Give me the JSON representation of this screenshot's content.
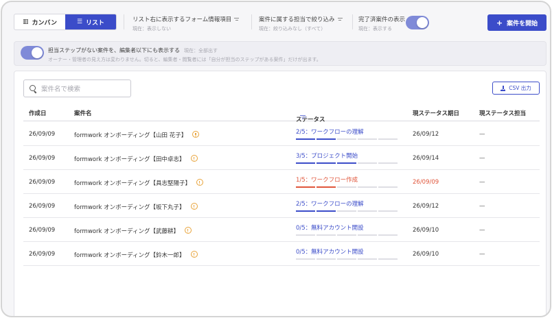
{
  "view_toggle": {
    "kanban_label": "カンバン",
    "list_label": "リスト",
    "active": "list"
  },
  "filters": [
    {
      "title": "リスト右に表示するフォーム情報項目",
      "sub": "現在：表示しない"
    },
    {
      "title": "案件に属する担当で絞り込み",
      "sub": "現在：絞り込みなし（すべて）"
    }
  ],
  "completed_toggle": {
    "title": "完了済案件の表示",
    "sub": "現在：表示する",
    "on": true
  },
  "start_button": {
    "label": "案件を開始"
  },
  "banner": {
    "title": "担当ステップがない案件を、編集者以下にも表示する",
    "note": "現在：全部出す",
    "desc": "オーナー・管理者の見え方は変わりません。切ると、編集者・閲覧者には「自分が担当のステップがある案件」だけが出ます。",
    "on": true
  },
  "search": {
    "placeholder": "案件名で検索"
  },
  "csv_button": {
    "label": "CSV 出力"
  },
  "table": {
    "headers": {
      "created": "作成日",
      "name": "案件名",
      "status": "ステータス",
      "due": "現ステータス期日",
      "owner": "現ステータス担当"
    },
    "rows": [
      {
        "created": "26/09/09",
        "name": "formwork オンボーディング【山田 花子】",
        "status": "2/5：ワークフローの理解",
        "step": 2,
        "total": 5,
        "late": false,
        "due": "26/09/12",
        "owner": "—"
      },
      {
        "created": "26/09/09",
        "name": "formwork オンボーディング【田中卓志】",
        "status": "3/5：プロジェクト開始",
        "step": 3,
        "total": 5,
        "late": false,
        "due": "26/09/14",
        "owner": "—"
      },
      {
        "created": "26/09/09",
        "name": "formwork オンボーディング【具志堅陽子】",
        "status": "1/5：ワークフロー作成",
        "step": 1,
        "total": 5,
        "late": true,
        "due": "26/09/09",
        "owner": "—"
      },
      {
        "created": "26/09/09",
        "name": "formwork オンボーディング【坂下丸子】",
        "status": "2/5：ワークフローの理解",
        "step": 2,
        "total": 5,
        "late": false,
        "due": "26/09/12",
        "owner": "—"
      },
      {
        "created": "26/09/09",
        "name": "formwork オンボーディング【武藤耕】",
        "status": "0/5：無料アカウント開設",
        "step": 0,
        "total": 5,
        "late": false,
        "due": "26/09/10",
        "owner": "—"
      },
      {
        "created": "26/09/09",
        "name": "formwork オンボーディング【鈴木一郎】",
        "status": "0/5：無料アカウント開設",
        "step": 0,
        "total": 5,
        "late": false,
        "due": "26/09/10",
        "owner": "—"
      }
    ]
  },
  "colors": {
    "accent": "#3b4cc9",
    "late": "#e0553a",
    "warning": "#e8a33a"
  }
}
